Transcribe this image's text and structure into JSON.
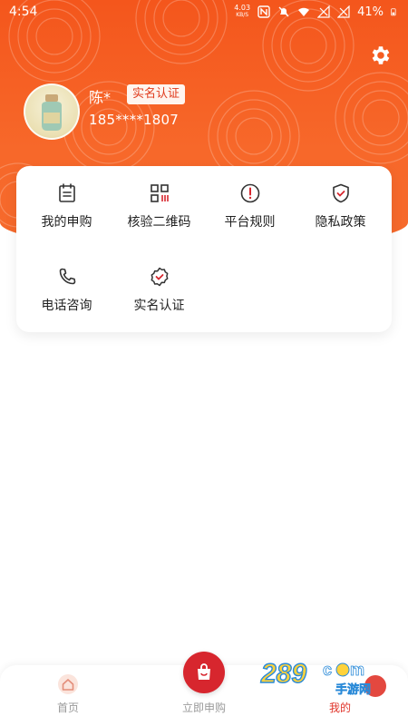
{
  "status": {
    "time": "4:54",
    "net_speed_value": "4.03",
    "net_speed_unit": "KB/S",
    "battery": "41%"
  },
  "profile": {
    "name": "陈*",
    "verify_badge": "实名认证",
    "phone": "185****1807"
  },
  "menu": {
    "items": [
      {
        "label": "我的申购",
        "icon": "calendar-icon"
      },
      {
        "label": "核验二维码",
        "icon": "qr-code-icon"
      },
      {
        "label": "平台规则",
        "icon": "exclamation-circle-icon"
      },
      {
        "label": "隐私政策",
        "icon": "shield-check-icon"
      },
      {
        "label": "电话咨询",
        "icon": "phone-icon"
      },
      {
        "label": "实名认证",
        "icon": "verified-badge-icon"
      }
    ]
  },
  "tabbar": {
    "home": "首页",
    "buy": "立即申购",
    "mine": "我的"
  },
  "watermark": {
    "text": "289",
    "suffix": "手游网"
  },
  "colors": {
    "brand_orange": "#f4561c",
    "accent_red": "#d7262e",
    "active_tab": "#e0342a"
  }
}
